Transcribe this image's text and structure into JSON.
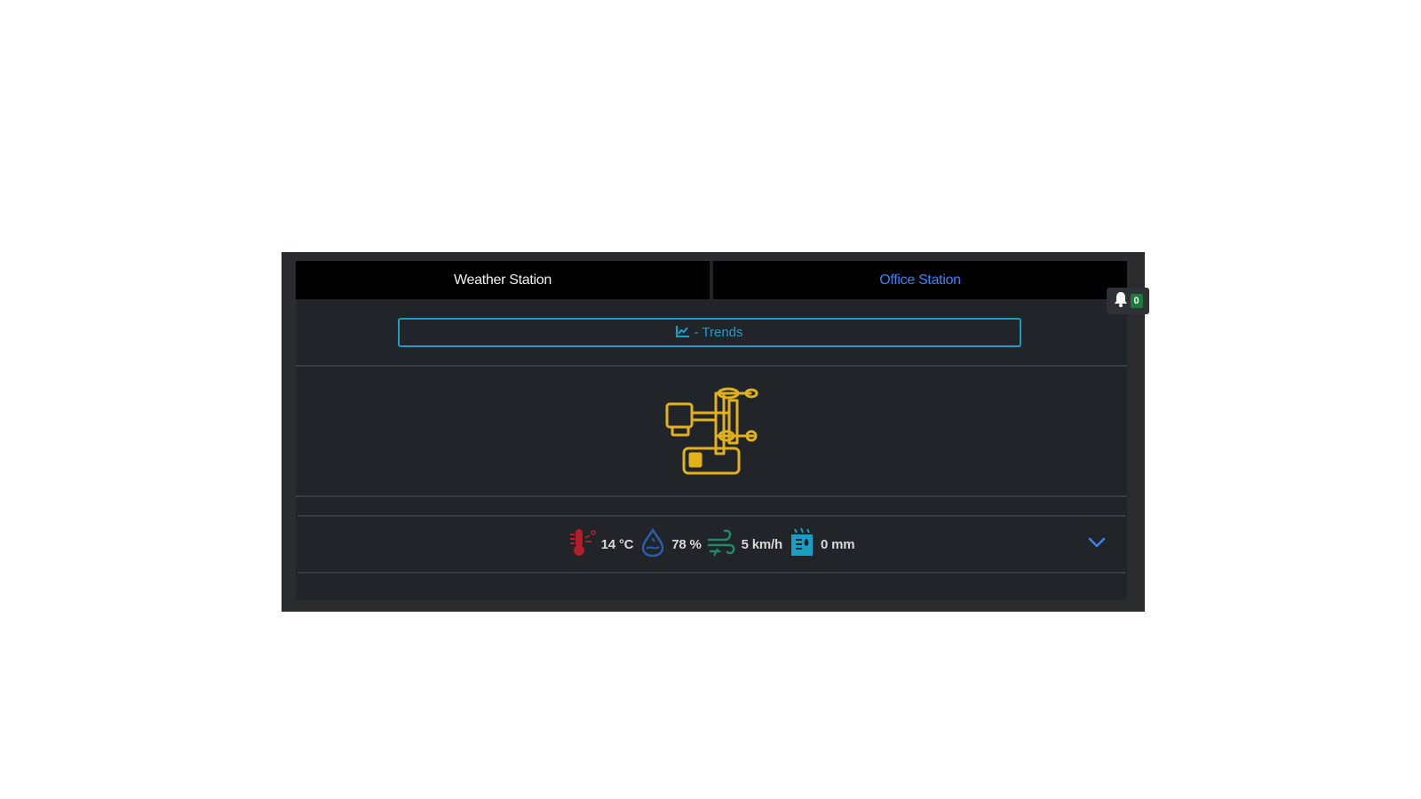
{
  "tabs": [
    {
      "label": "Weather Station",
      "color": "#f2f2f2"
    },
    {
      "label": "Office Station",
      "color": "#3b82f6"
    }
  ],
  "notifications": {
    "count": "0",
    "icon": "bell-icon"
  },
  "trends_button": {
    "label": "- Trends",
    "icon": "chart-line-icon",
    "color": "#1e9ecf"
  },
  "device": {
    "icon": "weather-station-icon",
    "color": "#e2b21a"
  },
  "metrics": [
    {
      "icon": "thermometer-icon",
      "value": "14 °C",
      "color": "#b01e2a"
    },
    {
      "icon": "humidity-drop-icon",
      "value": "78 %",
      "color": "#2c5fa8"
    },
    {
      "icon": "wind-icon",
      "value": "5 km/h",
      "color": "#1f8a6a"
    },
    {
      "icon": "rain-gauge-icon",
      "value": "0 mm",
      "color": "#1a9fc4"
    }
  ],
  "expand_icon": "chevron-down-icon"
}
